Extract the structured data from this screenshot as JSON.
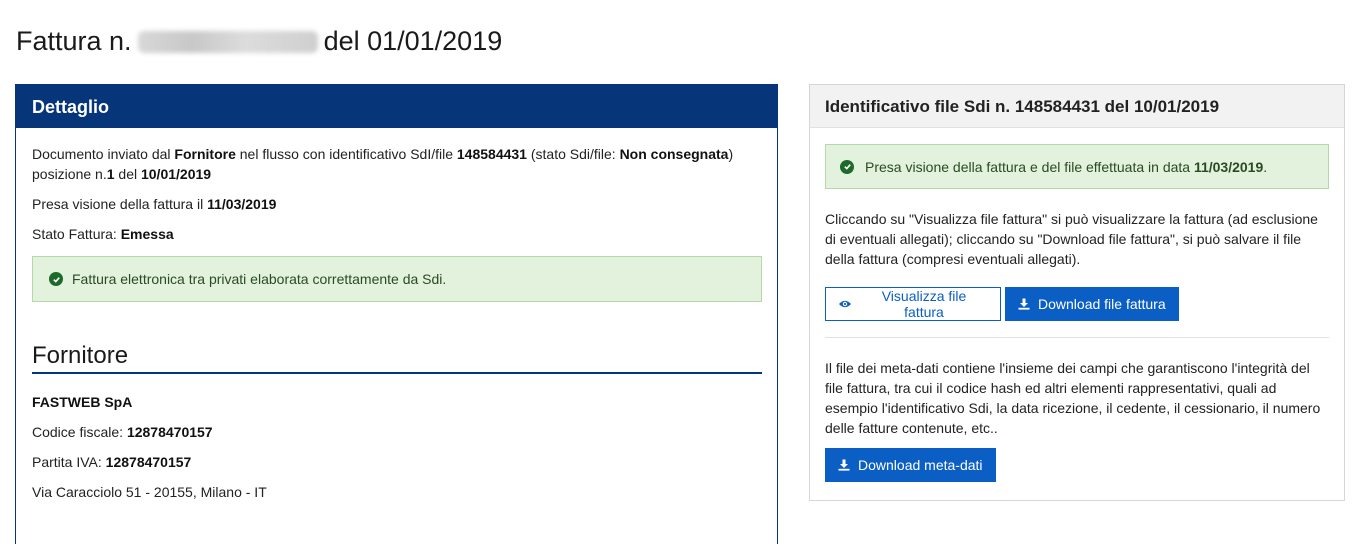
{
  "page": {
    "title_prefix": "Fattura n.",
    "title_suffix": "del 01/01/2019"
  },
  "left": {
    "header": "Dettaglio",
    "doc_text_1": "Documento inviato dal ",
    "doc_role": "Fornitore",
    "doc_text_2": " nel flusso con identificativo SdI/file ",
    "doc_file_id": "148584431",
    "doc_text_3": " (stato Sdi/file: ",
    "doc_status": "Non consegnata",
    "doc_text_4": ") posizione n.",
    "doc_position": "1",
    "doc_text_5": " del ",
    "doc_date": "10/01/2019",
    "viewed_label": "Presa visione della fattura il ",
    "viewed_date": "11/03/2019",
    "status_label": "Stato Fattura: ",
    "status_value": "Emessa",
    "success_message": "Fattura elettronica tra privati elaborata correttamente da Sdi."
  },
  "supplier": {
    "section_title": "Fornitore",
    "name": "FASTWEB SpA",
    "tax_code_label": "Codice fiscale: ",
    "tax_code": "12878470157",
    "vat_label": "Partita IVA: ",
    "vat": "12878470157",
    "address": "Via Caracciolo 51 - 20155, Milano - IT"
  },
  "right": {
    "header": "Identificativo file Sdi n. 148584431 del 10/01/2019",
    "alert_text": "Presa visione della fattura e del file effettuata in data ",
    "alert_date": "11/03/2019",
    "alert_end": ".",
    "description": "Cliccando su \"Visualizza file fattura\" si può visualizzare la fattura (ad esclusione di eventuali allegati); cliccando su \"Download file fattura\", si può salvare il file della fattura (compresi eventuali allegati).",
    "view_button": "Visualizza file fattura",
    "download_button": "Download file fattura",
    "meta_description": "Il file dei meta-dati contiene l'insieme dei campi che garantiscono l'integrità del file fattura, tra cui il codice hash ed altri elementi rappresentativi, quali ad esempio l'identificativo Sdi, la data ricezione, il cedente, il cessionario, il numero delle fatture contenute, etc..",
    "meta_button": "Download meta-dati"
  },
  "icons": {
    "success": "check-circle-icon",
    "view": "eye-icon",
    "download": "download-icon"
  },
  "colors": {
    "primary_blue": "#06357a",
    "button_blue": "#0b5fc4",
    "success_bg": "#e2f2dd"
  }
}
